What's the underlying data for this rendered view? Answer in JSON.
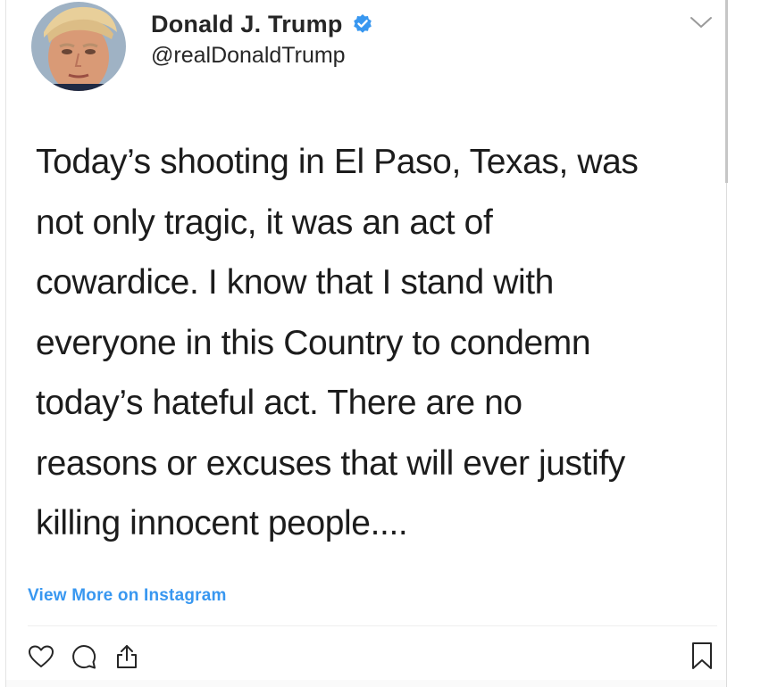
{
  "post": {
    "author": {
      "name": "Donald J. Trump",
      "handle": "@realDonaldTrump",
      "verified": true
    },
    "caption_lines": [
      "Today’s shooting in El Paso, Texas, was",
      "not only tragic, it was an act of",
      "cowardice. I know that I stand with",
      "everyone in this Country to condemn",
      "today’s hateful act. There are no",
      "reasons or excuses that will ever justify",
      "killing innocent people...."
    ],
    "view_more_label": "View More on Instagram"
  },
  "icons": {
    "verified": "verified-badge-icon",
    "menu": "chevron-down-icon",
    "like": "heart-icon",
    "comment": "comment-icon",
    "share": "share-icon",
    "save": "bookmark-icon"
  },
  "colors": {
    "link": "#3897f0",
    "verified": "#3897f0",
    "text": "#262626"
  }
}
